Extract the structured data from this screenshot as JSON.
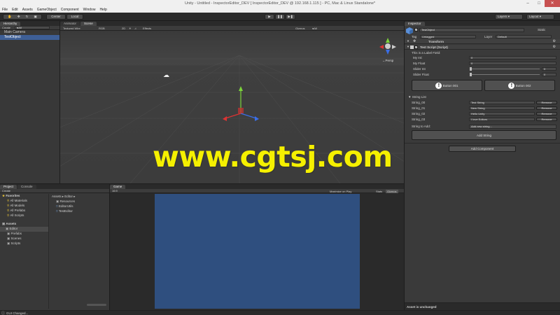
{
  "window": {
    "title": "Unity - Untitled - InspectorEditor_DEV [ InspectorEditor_DEV @ 192.168.1.115 ] - PC, Mac & Linux Standalone*"
  },
  "menu": [
    "File",
    "Edit",
    "Assets",
    "GameObject",
    "Component",
    "Window",
    "Help"
  ],
  "toolbar": {
    "center": "Center",
    "local": "Local",
    "layers": "Layers",
    "layout": "Layout"
  },
  "hierarchy": {
    "tab": "Hierarchy",
    "create": "Create",
    "search": "●All",
    "items": [
      "Main Camera",
      "TestObject"
    ]
  },
  "scene_view": {
    "tabs": [
      "Animator",
      "Scene"
    ],
    "shading": "Textured Wire",
    "render": "RGB",
    "mode_2d": "2D",
    "effects": "Effects",
    "gizmos": "Gizmos",
    "search": "●All",
    "persp": "←Persp"
  },
  "watermark": "www.cgtsj.com",
  "inspector": {
    "tab": "Inspector",
    "object_name": "TestObject",
    "static": "Static",
    "tag_label": "Tag",
    "tag_value": "Untagged",
    "layer_label": "Layer",
    "layer_value": "Default",
    "transform": "Transform",
    "script_title": "Test Script (Script)",
    "label_field": "This is a Label Field:",
    "fields": [
      {
        "label": "My Int:",
        "value": "0"
      },
      {
        "label": "My Float",
        "value": "0"
      },
      {
        "label": "Slider Int",
        "value": "0"
      },
      {
        "label": "Slider Float",
        "value": "0"
      }
    ],
    "button1": "Button 001",
    "button2": "Button 002",
    "string_list": "String List",
    "strings": [
      {
        "label": "String_00",
        "value": "Test String",
        "remove": "Remove"
      },
      {
        "label": "String_01",
        "value": "New String",
        "remove": "Remove"
      },
      {
        "label": "String_02",
        "value": "Hello Unity",
        "remove": "Remove"
      },
      {
        "label": "String_03",
        "value": "I love Editors",
        "remove": "Remove"
      }
    ],
    "string_to_add": "String to Add:",
    "add_placeholder": "Add new string...",
    "add_string": "Add String",
    "add_component": "Add Component",
    "status": "Asset is unchanged"
  },
  "project": {
    "tabs": [
      "Project",
      "Console"
    ],
    "create": "Create",
    "favorites": "Favorites",
    "favorite_items": [
      "All Materials",
      "All Models",
      "All Prefabs",
      "All Scripts"
    ],
    "assets": "Assets",
    "asset_items": [
      "Editor",
      "Prefabs",
      "Scenes",
      "Scripts"
    ],
    "breadcrumb": "Assets ▸ Editor ▸",
    "files": [
      "Resources",
      "EditorUtils",
      "TestEditor"
    ]
  },
  "game": {
    "tab": "Game",
    "aspect": "16:9",
    "maximize": "Maximize on Play",
    "stats": "Stats",
    "gizmos": "Gizmos"
  },
  "statusbar": "GUI Changed...",
  "colors": {
    "selection": "#3e5f96",
    "game_bg": "#2f4f7f",
    "watermark": "#f5f000"
  }
}
